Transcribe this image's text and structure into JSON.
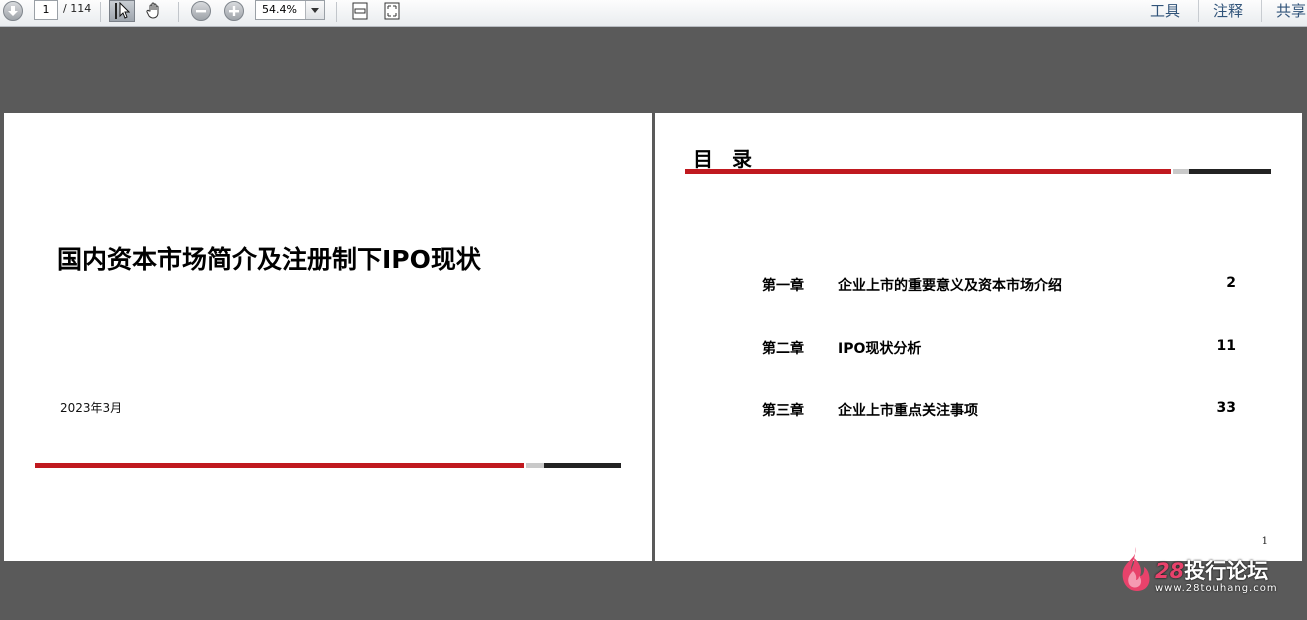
{
  "toolbar": {
    "page_current": "1",
    "page_total": "/ 114",
    "zoom": "54.4%",
    "menus": [
      "工具",
      "注释",
      "共享"
    ]
  },
  "slide1": {
    "title": "国内资本市场简介及注册制下IPO现状",
    "date": "2023年3月"
  },
  "slide2": {
    "heading": "目 录",
    "toc": [
      {
        "chapter": "第一章",
        "name": "企业上市的重要意义及资本市场介绍",
        "page": "2"
      },
      {
        "chapter": "第二章",
        "name": "IPO现状分析",
        "page": "11"
      },
      {
        "chapter": "第三章",
        "name": "企业上市重点关注事项",
        "page": "33"
      }
    ],
    "page_number": "1"
  },
  "watermark": {
    "brand_num": "28",
    "brand_text": "投行论坛",
    "url": "www.28touhang.com"
  },
  "colors": {
    "accent_red": "#c0191f",
    "workspace": "#5a5a5a",
    "menu_link": "#31547a"
  }
}
